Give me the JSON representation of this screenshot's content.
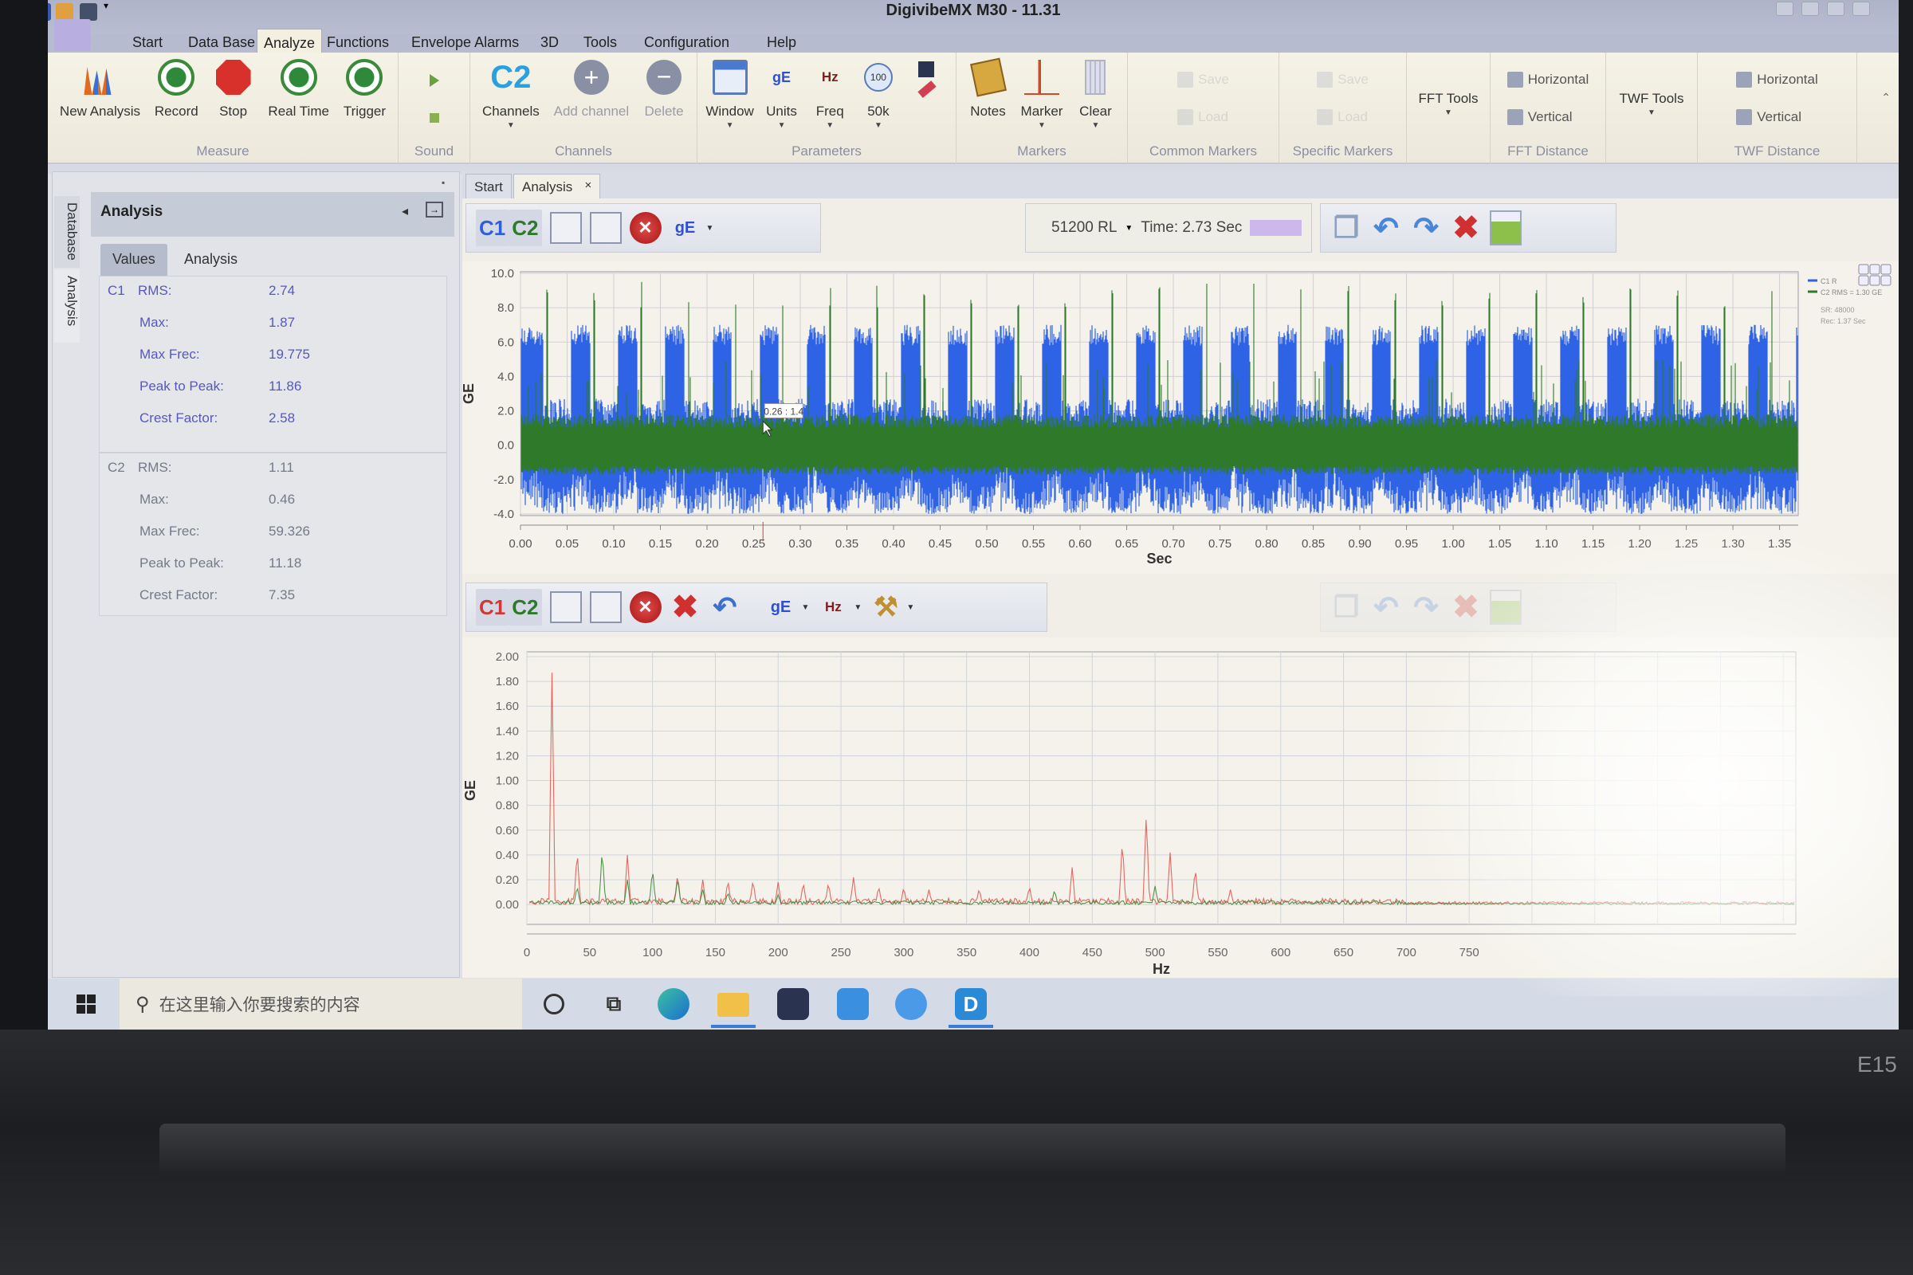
{
  "window": {
    "title": "DigivibeMX M30 - 11.31"
  },
  "menu_tabs": [
    "Start",
    "Data Base",
    "Analyze",
    "Functions",
    "Envelope Alarms",
    "3D",
    "Tools",
    "Configuration",
    "Help"
  ],
  "active_menu_tab": "Analyze",
  "ribbon": {
    "groups": [
      {
        "label": "Measure",
        "buttons": [
          {
            "label": "New Analysis",
            "icon": "new-analysis-icon"
          },
          {
            "label": "Record",
            "icon": "record-icon"
          },
          {
            "label": "Stop",
            "icon": "stop-icon"
          },
          {
            "label": "Real Time",
            "icon": "real-time-icon"
          },
          {
            "label": "Trigger",
            "icon": "trigger-icon"
          }
        ]
      },
      {
        "label": "Sound",
        "buttons": [
          {
            "label": "",
            "icon": "play-icon"
          },
          {
            "label": "",
            "icon": "stop-square-icon"
          }
        ]
      },
      {
        "label": "Channels",
        "buttons": [
          {
            "label": "Channels",
            "icon": "c2-channel-icon",
            "glyph": "C2",
            "dropdown": true
          },
          {
            "label": "Add channel",
            "icon": "add-channel-icon",
            "disabled": true
          },
          {
            "label": "Delete",
            "icon": "delete-channel-icon",
            "disabled": true
          }
        ]
      },
      {
        "label": "Parameters",
        "buttons": [
          {
            "label": "Window",
            "icon": "window-icon",
            "dropdown": true
          },
          {
            "label": "Units",
            "icon": "units-icon",
            "glyph": "gE",
            "dropdown": true
          },
          {
            "label": "Freq",
            "icon": "freq-icon",
            "glyph": "Hz",
            "dropdown": true
          },
          {
            "label": "50k",
            "icon": "zoom-100-icon",
            "glyph": "100",
            "dropdown": true
          },
          {
            "label": "",
            "icon": "save-eraser-icon"
          }
        ]
      },
      {
        "label": "Markers",
        "buttons": [
          {
            "label": "Notes",
            "icon": "notes-icon"
          },
          {
            "label": "Marker",
            "icon": "marker-icon",
            "dropdown": true
          },
          {
            "label": "Clear",
            "icon": "clear-icon",
            "dropdown": true
          }
        ]
      },
      {
        "label": "Common Markers",
        "small": [
          {
            "label": "Save",
            "icon": "save-icon"
          },
          {
            "label": "Load",
            "icon": "load-icon"
          }
        ]
      },
      {
        "label": "Specific Markers",
        "small": [
          {
            "label": "Save",
            "icon": "save-icon"
          },
          {
            "label": "Load",
            "icon": "load-icon"
          }
        ]
      },
      {
        "label": "",
        "buttons": [
          {
            "label": "FFT Tools",
            "icon": "none",
            "dropdown": true
          }
        ]
      },
      {
        "label": "FFT Distance",
        "small": [
          {
            "label": "Horizontal",
            "icon": "horizontal-icon"
          },
          {
            "label": "Vertical",
            "icon": "vertical-icon"
          }
        ]
      },
      {
        "label": "",
        "buttons": [
          {
            "label": "TWF Tools",
            "icon": "none",
            "dropdown": true
          }
        ]
      },
      {
        "label": "TWF Distance",
        "small": [
          {
            "label": "Horizontal",
            "icon": "horizontal-icon"
          },
          {
            "label": "Vertical",
            "icon": "vertical-icon"
          }
        ]
      }
    ]
  },
  "left_panel": {
    "side_tabs": [
      "Database",
      "Analysis"
    ],
    "title": "Analysis",
    "tabs": [
      "Values",
      "Analysis"
    ],
    "selected_tab": "Values",
    "channels": [
      {
        "name": "C1",
        "color": "#5458c0",
        "rows": [
          {
            "label": "RMS:",
            "value": "2.74"
          },
          {
            "label": "Max:",
            "value": "1.87"
          },
          {
            "label": "Max Frec:",
            "value": "19.775"
          },
          {
            "label": "Peak to Peak:",
            "value": "11.86"
          },
          {
            "label": "Crest Factor:",
            "value": "2.58"
          }
        ]
      },
      {
        "name": "C2",
        "color": "#737a8a",
        "rows": [
          {
            "label": "RMS:",
            "value": "1.11"
          },
          {
            "label": "Max:",
            "value": "0.46"
          },
          {
            "label": "Max Frec:",
            "value": "59.326"
          },
          {
            "label": "Peak to Peak:",
            "value": "11.18"
          },
          {
            "label": "Crest Factor:",
            "value": "7.35"
          }
        ]
      }
    ]
  },
  "doc_tabs": [
    "Start",
    "Analysis"
  ],
  "active_doc_tab": "Analysis",
  "twf_toolbar": {
    "c1": "C1",
    "c2": "C2",
    "unit": "gE",
    "record_length": "51200 RL",
    "time": "Time: 2.73 Sec"
  },
  "fft_toolbar": {
    "c1": "C1",
    "c2": "C2",
    "unit": "gE",
    "freq_unit": "Hz"
  },
  "twf_legend": {
    "c1": "C1 R",
    "c2": "C2 RMS = 1.30 GE",
    "sr": "SR: 48000",
    "rec": "Rec: 1.37 Sec"
  },
  "cursor_tooltip": "0.26 : 1.4",
  "taskbar": {
    "search_placeholder": "在这里输入你要搜索的内容",
    "apps": [
      "cortana-icon",
      "task-view-icon",
      "edge-icon",
      "file-explorer-icon",
      "store-icon",
      "mail-icon",
      "clock-app-icon",
      "digivibe-icon"
    ],
    "digivibe_glyph": "D"
  },
  "laptop_label": "E15",
  "chart_data": [
    {
      "type": "line",
      "title": "",
      "xlabel": "Sec",
      "ylabel": "GE",
      "xlim": [
        0,
        1.37
      ],
      "ylim": [
        -4.0,
        10.0
      ],
      "xticks": [
        "0.00",
        "0.05",
        "0.10",
        "0.15",
        "0.20",
        "0.25",
        "0.30",
        "0.35",
        "0.40",
        "0.45",
        "0.50",
        "0.55",
        "0.60",
        "0.65",
        "0.70",
        "0.75",
        "0.80",
        "0.85",
        "0.90",
        "0.95",
        "1.00",
        "1.05",
        "1.10",
        "1.15",
        "1.20",
        "1.25",
        "1.30",
        "1.35"
      ],
      "yticks": [
        "10.0",
        "8.0",
        "6.0",
        "4.0",
        "2.0",
        "0.0",
        "-2.0",
        "-4.0"
      ],
      "grid": true,
      "legend": "top-right",
      "series": [
        {
          "name": "C1",
          "color": "#2e63e6",
          "burst_period_sec": 0.0505,
          "burst_peak": 7.0,
          "baseline_range": [
            -4.0,
            1.2
          ]
        },
        {
          "name": "C2",
          "color": "#2f7a2a",
          "baseline_range": [
            -1.6,
            1.6
          ],
          "spike_peak": 9.5,
          "spike_period_sec": 0.0505
        }
      ],
      "annotation": {
        "x": 0.26,
        "y": 1.4
      }
    },
    {
      "type": "line",
      "title": "",
      "xlabel": "Hz",
      "ylabel": "GE",
      "xlim": [
        0,
        1010
      ],
      "ylim": [
        -0.16,
        2.0
      ],
      "xticks": [
        "0",
        "50",
        "100",
        "150",
        "200",
        "250",
        "300",
        "350",
        "400",
        "450",
        "500",
        "550",
        "600",
        "650",
        "700",
        "750"
      ],
      "yticks": [
        "2.00",
        "1.80",
        "1.60",
        "1.40",
        "1.20",
        "1.00",
        "0.80",
        "0.60",
        "0.40",
        "0.20",
        "0.00"
      ],
      "grid": true,
      "legend": "top-right",
      "series": [
        {
          "name": "C1",
          "color": "#e0504a",
          "noise_floor": 0.05,
          "peaks": [
            [
              20,
              1.87
            ],
            [
              40,
              0.44
            ],
            [
              80,
              0.4
            ],
            [
              120,
              0.25
            ],
            [
              140,
              0.2
            ],
            [
              160,
              0.2
            ],
            [
              180,
              0.2
            ],
            [
              200,
              0.18
            ],
            [
              220,
              0.18
            ],
            [
              240,
              0.18
            ],
            [
              260,
              0.22
            ],
            [
              280,
              0.15
            ],
            [
              300,
              0.14
            ],
            [
              320,
              0.12
            ],
            [
              360,
              0.13
            ],
            [
              400,
              0.15
            ],
            [
              434,
              0.3
            ],
            [
              474,
              0.53
            ],
            [
              493,
              0.74
            ],
            [
              512,
              0.42
            ],
            [
              532,
              0.3
            ],
            [
              560,
              0.12
            ]
          ]
        },
        {
          "name": "C2",
          "color": "#3f8a3a",
          "noise_floor": 0.03,
          "peaks": [
            [
              40,
              0.15
            ],
            [
              60,
              0.45
            ],
            [
              80,
              0.2
            ],
            [
              100,
              0.29
            ],
            [
              120,
              0.22
            ],
            [
              140,
              0.12
            ],
            [
              160,
              0.1
            ],
            [
              200,
              0.08
            ],
            [
              420,
              0.12
            ],
            [
              500,
              0.15
            ]
          ]
        }
      ]
    }
  ]
}
